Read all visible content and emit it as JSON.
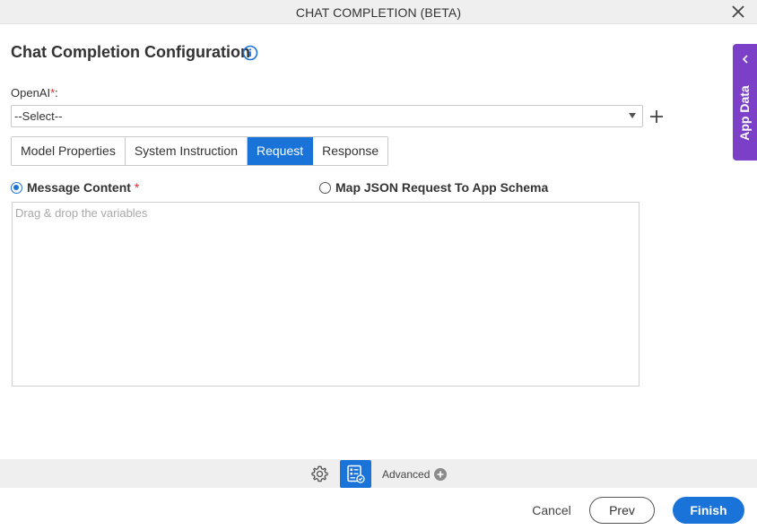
{
  "window": {
    "title": "CHAT COMPLETION (BETA)"
  },
  "page": {
    "heading": "Chat Completion Configuration"
  },
  "openai_field": {
    "label": "OpenAI",
    "required_mark": "*",
    "label_suffix": ":",
    "selected_value": "--Select--"
  },
  "tabs": [
    {
      "label": "Model Properties",
      "active": false
    },
    {
      "label": "System Instruction",
      "active": false
    },
    {
      "label": "Request",
      "active": true
    },
    {
      "label": "Response",
      "active": false
    }
  ],
  "request": {
    "radio_message_content": {
      "label": "Message Content",
      "required_mark": "*",
      "checked": true
    },
    "radio_map_json": {
      "label": "Map JSON Request To App Schema",
      "checked": false
    },
    "message_placeholder": "Drag & drop the variables"
  },
  "side_panel": {
    "label": "App Data"
  },
  "bottom_bar": {
    "advanced_label": "Advanced"
  },
  "footer": {
    "cancel_label": "Cancel",
    "prev_label": "Prev",
    "finish_label": "Finish"
  },
  "icons": {
    "close": "close-icon",
    "info": "info-icon",
    "caret": "chevron-down-icon",
    "add": "plus-icon",
    "side_chevron": "chevron-left-icon",
    "settings": "gear-icon",
    "form": "form-icon",
    "advanced_add": "plus-circle-icon"
  },
  "colors": {
    "primary": "#1a73d9",
    "side_panel": "#7b3fc8",
    "required": "#d32f2f",
    "titlebar_bg": "#efefef"
  }
}
